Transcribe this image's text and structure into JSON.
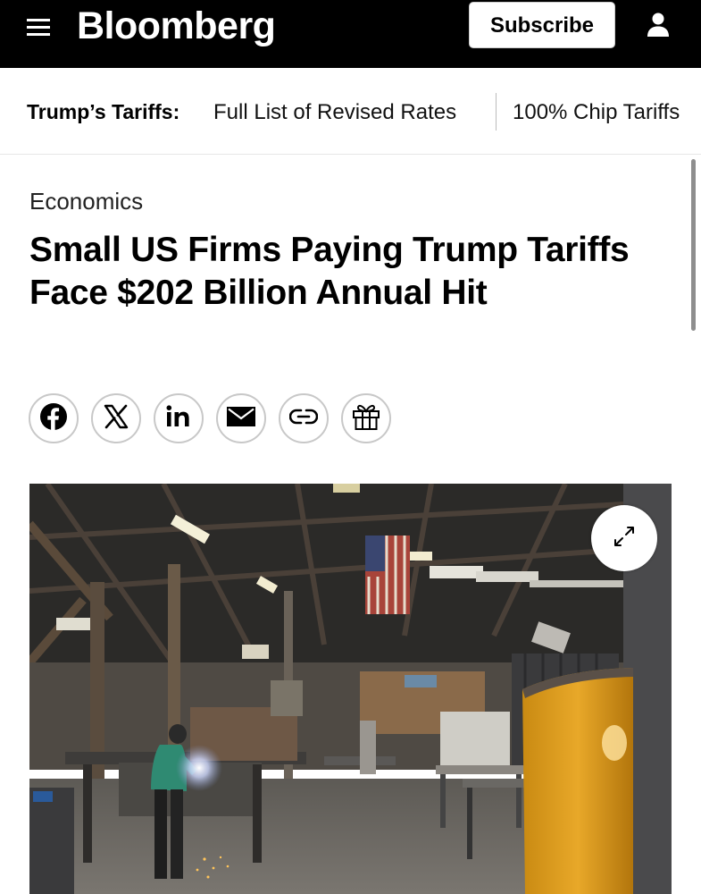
{
  "header": {
    "logo": "Bloomberg",
    "subscribe_label": "Subscribe"
  },
  "subnav": {
    "label": "Trump’s Tariffs:",
    "links": [
      "Full List of Revised Rates",
      "100% Chip Tariffs"
    ]
  },
  "article": {
    "category": "Economics",
    "headline": "Small US Firms Paying Trump Tariffs Face $202 Billion Annual Hit"
  },
  "share": {
    "icons": [
      "facebook-icon",
      "x-icon",
      "linkedin-icon",
      "email-icon",
      "link-icon",
      "gift-icon"
    ]
  },
  "hero_image": {
    "icon": "expand-icon"
  },
  "colors": {
    "header_bg": "#000000",
    "header_text": "#ffffff",
    "body_text": "#000000",
    "share_border": "#c8c8c8"
  }
}
